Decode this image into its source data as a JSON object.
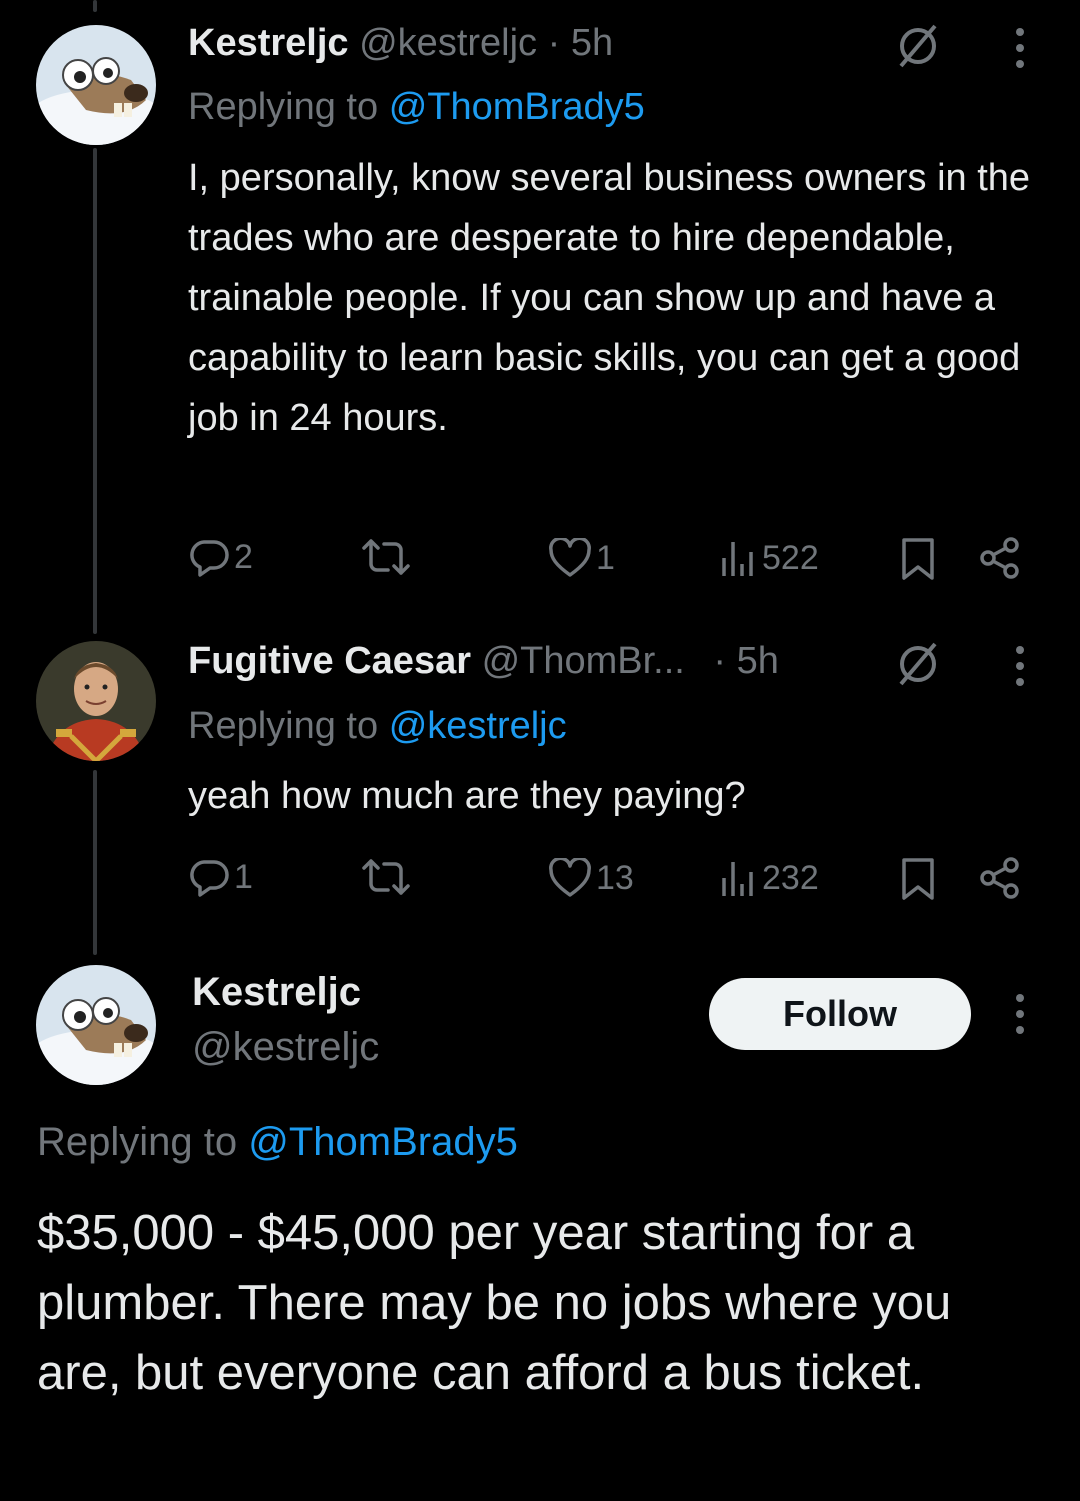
{
  "tweets": [
    {
      "name": "Kestreljc",
      "handle": "@kestreljc",
      "time": "· 5h",
      "replying_prefix": "Replying to",
      "replying_to": "@ThomBrady5",
      "text": "I, personally, know several business owners in the trades who are desperate to hire dependable, trainable people.  If you can show up and have a capability to learn basic skills, you can get a good job in 24 hours.",
      "replies": "2",
      "retweets": "",
      "likes": "1",
      "views": "522"
    },
    {
      "name": "Fugitive Caesar",
      "handle": "@ThomBr...",
      "time": "· 5h",
      "replying_prefix": "Replying to",
      "replying_to": "@kestreljc",
      "text": "yeah how much are they paying?",
      "replies": "1",
      "retweets": "",
      "likes": "13",
      "views": "232"
    }
  ],
  "main_tweet": {
    "name": "Kestreljc",
    "handle": "@kestreljc",
    "follow_label": "Follow",
    "replying_prefix": "Replying to",
    "replying_to": "@ThomBrady5",
    "text": "$35,000 - $45,000 per year starting for a plumber.  There may be no jobs where you are, but everyone can afford a bus ticket."
  },
  "icons": [
    "reply-icon",
    "retweet-icon",
    "like-icon",
    "views-icon",
    "bookmark-icon",
    "share-icon",
    "more-icon",
    "grok-icon"
  ],
  "colors": {
    "background": "#000000",
    "text": "#e7e9ea",
    "muted": "#71767b",
    "link": "#1d9bf0",
    "follow_bg": "#eff3f4"
  }
}
